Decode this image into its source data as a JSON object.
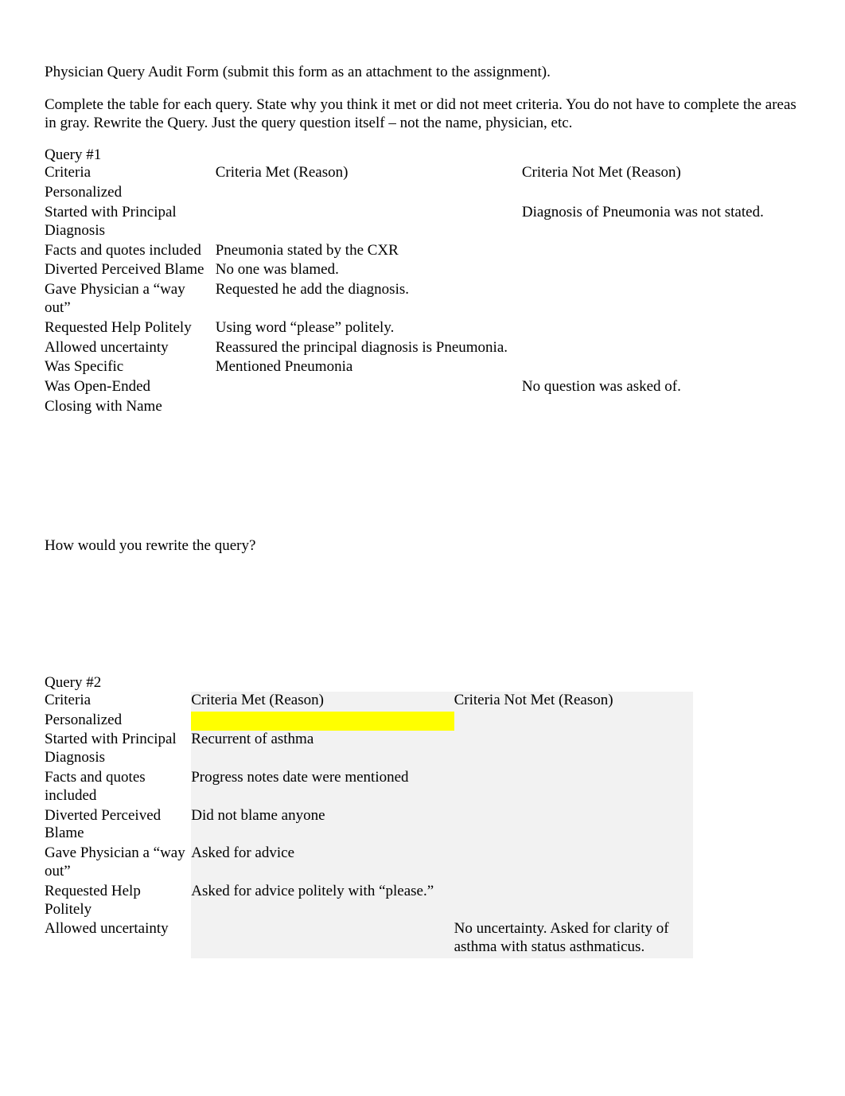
{
  "intro": {
    "line1": "Physician Query Audit Form (submit this form as an attachment to the assignment).",
    "line2": "Complete the table for each query.  State why you think it met or did not meet criteria.    You do not have to complete the areas in gray.   Rewrite the Query.   Just the query question itself – not the name, physician, etc."
  },
  "headers": {
    "criteria": "Criteria",
    "met": "Criteria Met (Reason)",
    "notmet": "Criteria Not Met (Reason)"
  },
  "query1": {
    "title": "Query #1",
    "rows": [
      {
        "criteria": "Personalized",
        "met": "",
        "notmet": ""
      },
      {
        "criteria": "Started with Principal Diagnosis",
        "met": "",
        "notmet": "Diagnosis of Pneumonia was not stated."
      },
      {
        "criteria": "Facts and quotes included",
        "met": "Pneumonia stated by the CXR",
        "notmet": ""
      },
      {
        "criteria": "Diverted Perceived Blame",
        "met": "No one was blamed.",
        "notmet": ""
      },
      {
        "criteria": "Gave Physician a “way out”",
        "met": "Requested he add the diagnosis.",
        "notmet": ""
      },
      {
        "criteria": "Requested Help Politely",
        "met": "Using word “please” politely.",
        "notmet": ""
      },
      {
        "criteria": "Allowed uncertainty",
        "met": "Reassured the principal diagnosis is Pneumonia.",
        "notmet": ""
      },
      {
        "criteria": "Was Specific",
        "met": "Mentioned Pneumonia",
        "notmet": ""
      },
      {
        "criteria": "Was Open-Ended",
        "met": "",
        "notmet": "No question was asked of."
      },
      {
        "criteria": "Closing with Name",
        "met": "",
        "notmet": ""
      }
    ]
  },
  "rewrite_prompt": "How would you rewrite the query?",
  "query2": {
    "title": "Query #2",
    "rows": [
      {
        "criteria": "Personalized",
        "met": "",
        "notmet": "",
        "yellow": true
      },
      {
        "criteria": "Started with Principal Diagnosis",
        "met": "Recurrent of asthma",
        "notmet": ""
      },
      {
        "criteria": "Facts and quotes included",
        "met": "Progress notes date were mentioned",
        "notmet": ""
      },
      {
        "criteria": "Diverted Perceived Blame",
        "met": "Did not blame anyone",
        "notmet": ""
      },
      {
        "criteria": "Gave Physician a “way out”",
        "met": "Asked for advice",
        "notmet": ""
      },
      {
        "criteria": "Requested Help Politely",
        "met": "Asked for advice politely with “please.”",
        "notmet": ""
      },
      {
        "criteria": "Allowed uncertainty",
        "met": "",
        "notmet": "No uncertainty. Asked for clarity of asthma with status asthmaticus."
      }
    ]
  }
}
